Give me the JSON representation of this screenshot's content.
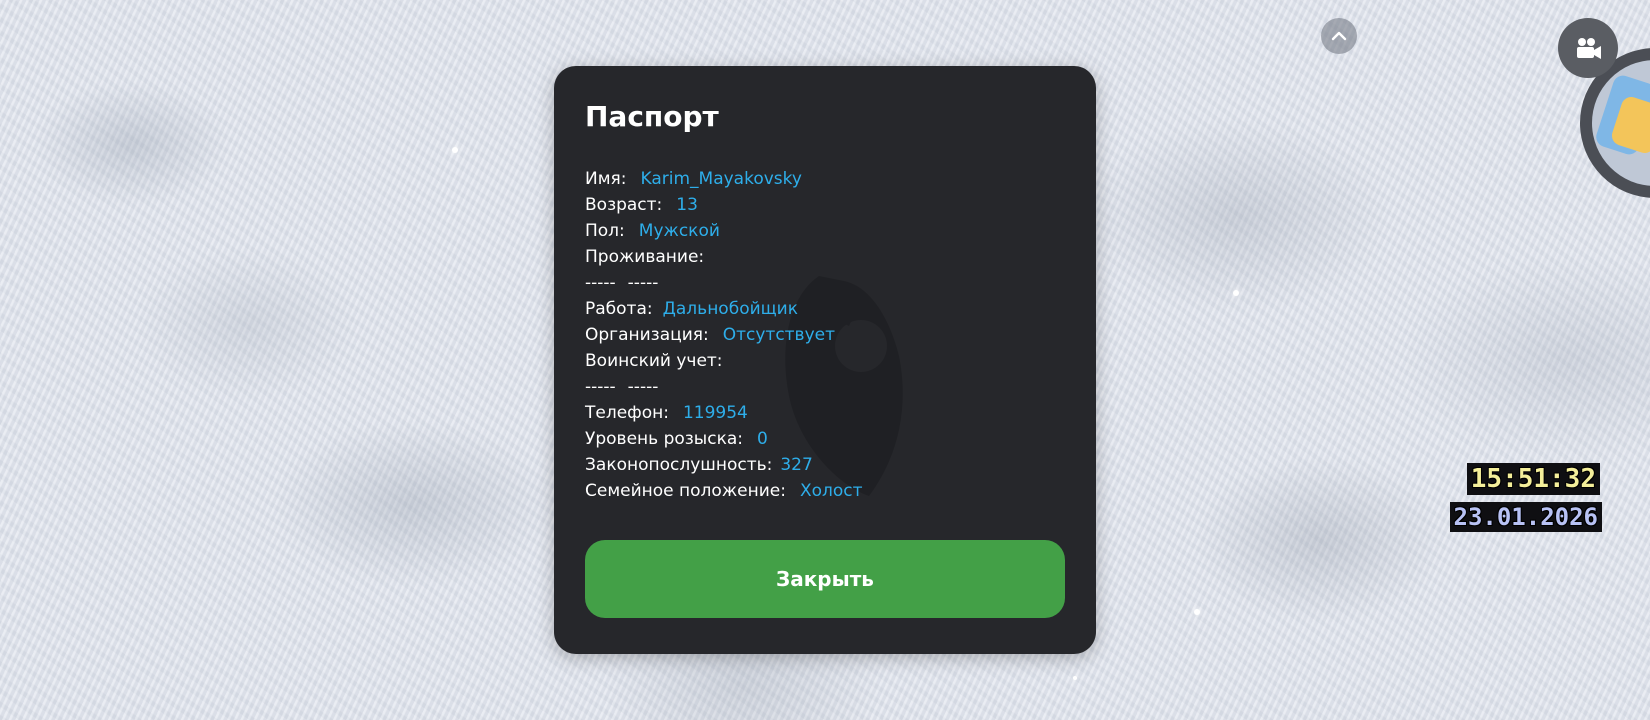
{
  "passport": {
    "title": "Паспорт",
    "fields": {
      "name": {
        "label": "Имя:",
        "value": "Karim_Mayakovsky"
      },
      "age": {
        "label": "Возраст:",
        "value": "13"
      },
      "sex": {
        "label": "Пол:",
        "value": "Мужской"
      },
      "residence": {
        "label": "Проживание:",
        "line": [
          "-----",
          "-----"
        ]
      },
      "job": {
        "label": "Работа:",
        "value": "Дальнобойщик"
      },
      "organization": {
        "label": "Организация:",
        "value": "Отсутствует"
      },
      "military": {
        "label": "Воинский учет:",
        "line": [
          "-----",
          "-----"
        ]
      },
      "phone": {
        "label": "Телефон:",
        "value": "119954"
      },
      "wanted": {
        "label": "Уровень розыска:",
        "value": "0"
      },
      "law": {
        "label": "Законопослушность:",
        "value": "327"
      },
      "marital": {
        "label": "Семейное положение:",
        "value": "Холост"
      }
    },
    "close_label": "Закрыть"
  },
  "hud": {
    "time": "15:51:32",
    "date": "23.01.2026",
    "collapse_icon": "chevron-up-icon",
    "camera_icon": "video-camera-icon"
  },
  "colors": {
    "modal_bg": "#26272b",
    "value_text": "#2eaeea",
    "button_bg": "#43a047",
    "clock_time": "#f4ef9a",
    "clock_date": "#b8c2f4"
  }
}
